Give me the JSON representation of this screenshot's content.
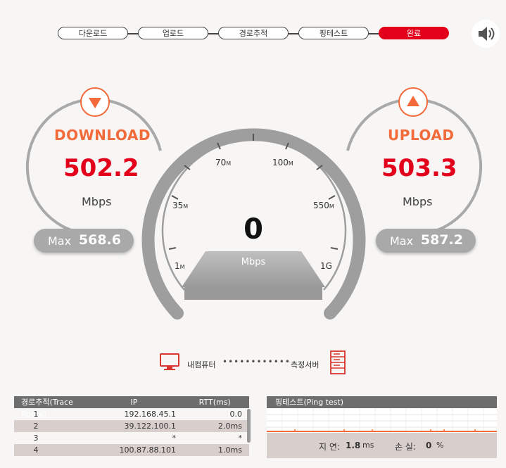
{
  "steps": [
    {
      "label": "다운로드",
      "state": "pending"
    },
    {
      "label": "업로드",
      "state": "pending"
    },
    {
      "label": "경로추적",
      "state": "pending"
    },
    {
      "label": "핑테스트",
      "state": "pending"
    },
    {
      "label": "완료",
      "state": "done"
    }
  ],
  "download": {
    "title": "DOWNLOAD",
    "value": "502.2",
    "unit": "Mbps",
    "max_label": "Max",
    "max_value": "568.6"
  },
  "upload": {
    "title": "UPLOAD",
    "value": "503.3",
    "unit": "Mbps",
    "max_label": "Max",
    "max_value": "587.2"
  },
  "gauge": {
    "value": "0",
    "unit": "Mbps",
    "ticks": [
      {
        "num": "1",
        "suffix": "M"
      },
      {
        "num": "35",
        "suffix": "M"
      },
      {
        "num": "70",
        "suffix": "M"
      },
      {
        "num": "100",
        "suffix": "M"
      },
      {
        "num": "550",
        "suffix": "M"
      },
      {
        "num": "1G",
        "suffix": ""
      }
    ]
  },
  "connection": {
    "left_label": "내컴퓨터",
    "dots": "••••••••••••",
    "right_label": "측정서버"
  },
  "trace": {
    "headers": [
      "경로추적(Trace Route)",
      "IP",
      "RTT(ms)"
    ],
    "rows": [
      [
        "1",
        "192.168.45.1",
        "0.0"
      ],
      [
        "2",
        "39.122.100.1",
        "2.0ms"
      ],
      [
        "3",
        "*",
        "*"
      ],
      [
        "4",
        "100.87.88.101",
        "1.0ms"
      ]
    ]
  },
  "ping": {
    "title": "핑테스트(Ping test)",
    "latency_label": "지  연:",
    "latency_value": "1.8",
    "latency_unit": "ms",
    "loss_label": "손  실:",
    "loss_value": "0",
    "loss_unit": "%"
  },
  "colors": {
    "accent": "#f36a3b",
    "red": "#e3001b",
    "gray": "#a9a9a9"
  }
}
